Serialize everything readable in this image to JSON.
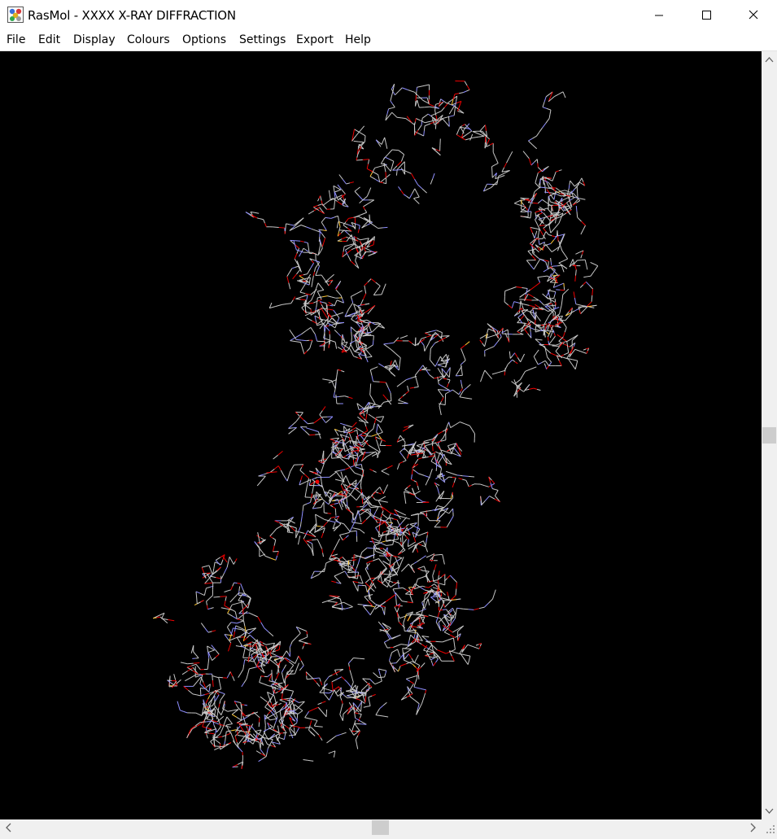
{
  "window": {
    "title": "RasMol - XXXX X-RAY DIFFRACTION",
    "controls": [
      "minimize-icon",
      "maximize-icon",
      "close-icon"
    ]
  },
  "menubar": {
    "items": [
      "File",
      "Edit",
      "Display",
      "Colours",
      "Options",
      "Settings",
      "Export",
      "Help"
    ]
  },
  "viewer": {
    "background": "#000000",
    "representation": "wireframe",
    "atom_colors": {
      "carbon": "#c8c8c8",
      "oxygen": "#f00000",
      "nitrogen": "#8f8fff",
      "sulfur": "#ffc832"
    }
  },
  "scrollbars": {
    "vertical_position": 0.5,
    "horizontal_position": 0.5
  }
}
